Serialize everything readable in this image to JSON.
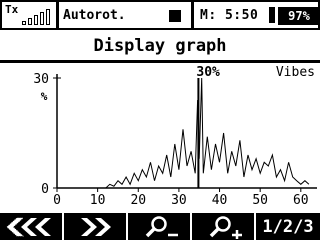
{
  "status_bar": {
    "tx_label": "Tx",
    "signal_bars": 5,
    "model_name": "Autorot.",
    "timer_text": "M: 5:50",
    "battery_percent": "97%"
  },
  "page": {
    "title": "Display graph"
  },
  "chart_data": {
    "type": "line",
    "title": "",
    "value_label": "30%",
    "series_label": "Vibes",
    "ylabel": "%",
    "ylim": [
      0,
      30
    ],
    "xlim": [
      0,
      63
    ],
    "x_ticks": [
      0,
      10,
      20,
      30,
      40,
      50,
      60
    ],
    "y_ticks": [
      0,
      30
    ],
    "marker_x": 34.8,
    "series": [
      {
        "x": [
          0,
          2,
          4,
          6,
          8,
          10,
          12,
          13,
          14,
          15,
          16,
          17,
          18,
          19,
          20,
          21,
          22,
          23,
          24,
          25,
          26,
          27,
          28,
          29,
          30,
          31,
          32,
          33,
          34,
          34.6,
          35,
          35.6,
          36,
          37,
          38,
          39,
          40,
          41,
          42,
          43,
          44,
          45,
          46,
          47,
          48,
          49,
          50,
          51,
          52,
          53,
          54,
          55,
          56,
          57,
          58,
          59,
          60,
          61,
          62
        ],
        "y": [
          0,
          0,
          0,
          0,
          0,
          0,
          0,
          1,
          0.5,
          2,
          1,
          3,
          1,
          4,
          2,
          5,
          3,
          7,
          2,
          6,
          4,
          9,
          3,
          12,
          5,
          16,
          6,
          10,
          4,
          24,
          8,
          30,
          4,
          14,
          5,
          12,
          7,
          15,
          4,
          10,
          6,
          13,
          3,
          9,
          5,
          8,
          4,
          7,
          6,
          9,
          3,
          5,
          2,
          7,
          3,
          2,
          1,
          2,
          1
        ]
      }
    ]
  },
  "toolbar": {
    "first_icon": "rewind-left-icon",
    "play_icon": "play-forward-icon",
    "zoom_out_icon": "zoom-out-icon",
    "zoom_in_icon": "zoom-in-icon",
    "page_label": "1/2/3"
  }
}
